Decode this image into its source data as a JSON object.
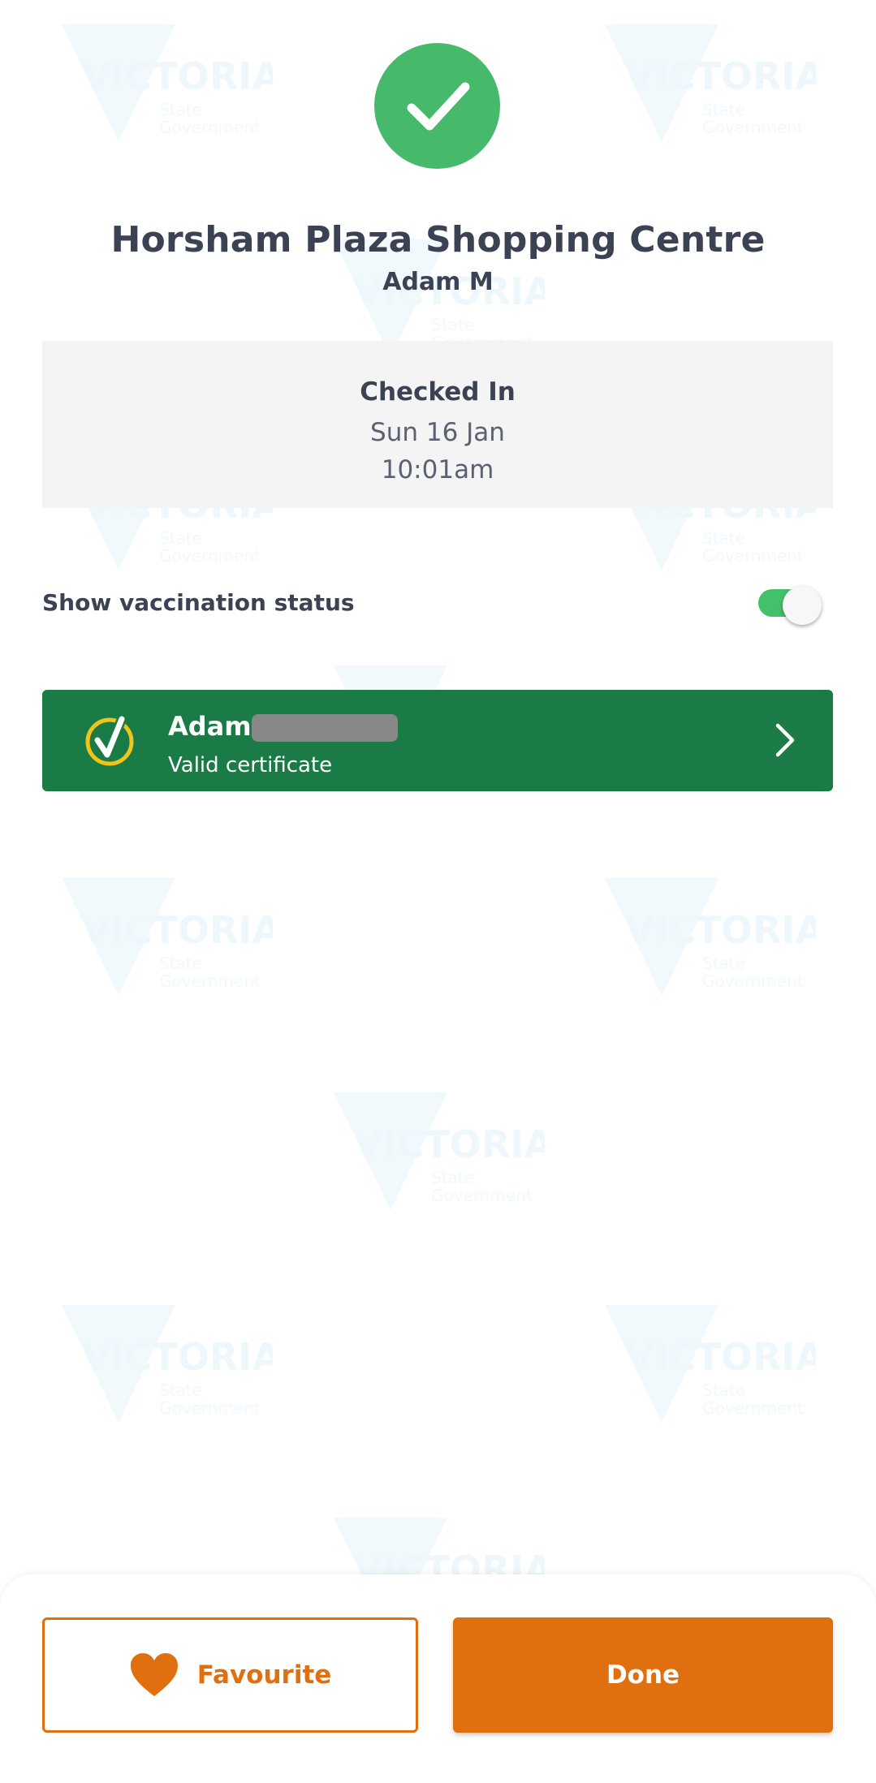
{
  "venue": {
    "title": "Horsham Plaza Shopping Centre",
    "person": "Adam M"
  },
  "checkin": {
    "status": "Checked In",
    "date": "Sun 16 Jan",
    "time": "10:01am"
  },
  "vaccination": {
    "label": "Show vaccination status",
    "toggle_on": true
  },
  "certificate": {
    "name": "Adam",
    "subtitle": "Valid certificate"
  },
  "actions": {
    "favourite_label": "Favourite",
    "done_label": "Done"
  },
  "watermark": {
    "line1": "VICTORIA",
    "line2": "State",
    "line3": "Government"
  },
  "colors": {
    "success_green": "#47b96b",
    "certificate_green": "#1b7b47",
    "accent_orange": "#e0700f",
    "toggle_green": "#43c06a",
    "text_dark": "#3b4254"
  },
  "icons": [
    "checkmark-icon",
    "certificate-badge-icon",
    "chevron-right-icon",
    "heart-icon"
  ]
}
